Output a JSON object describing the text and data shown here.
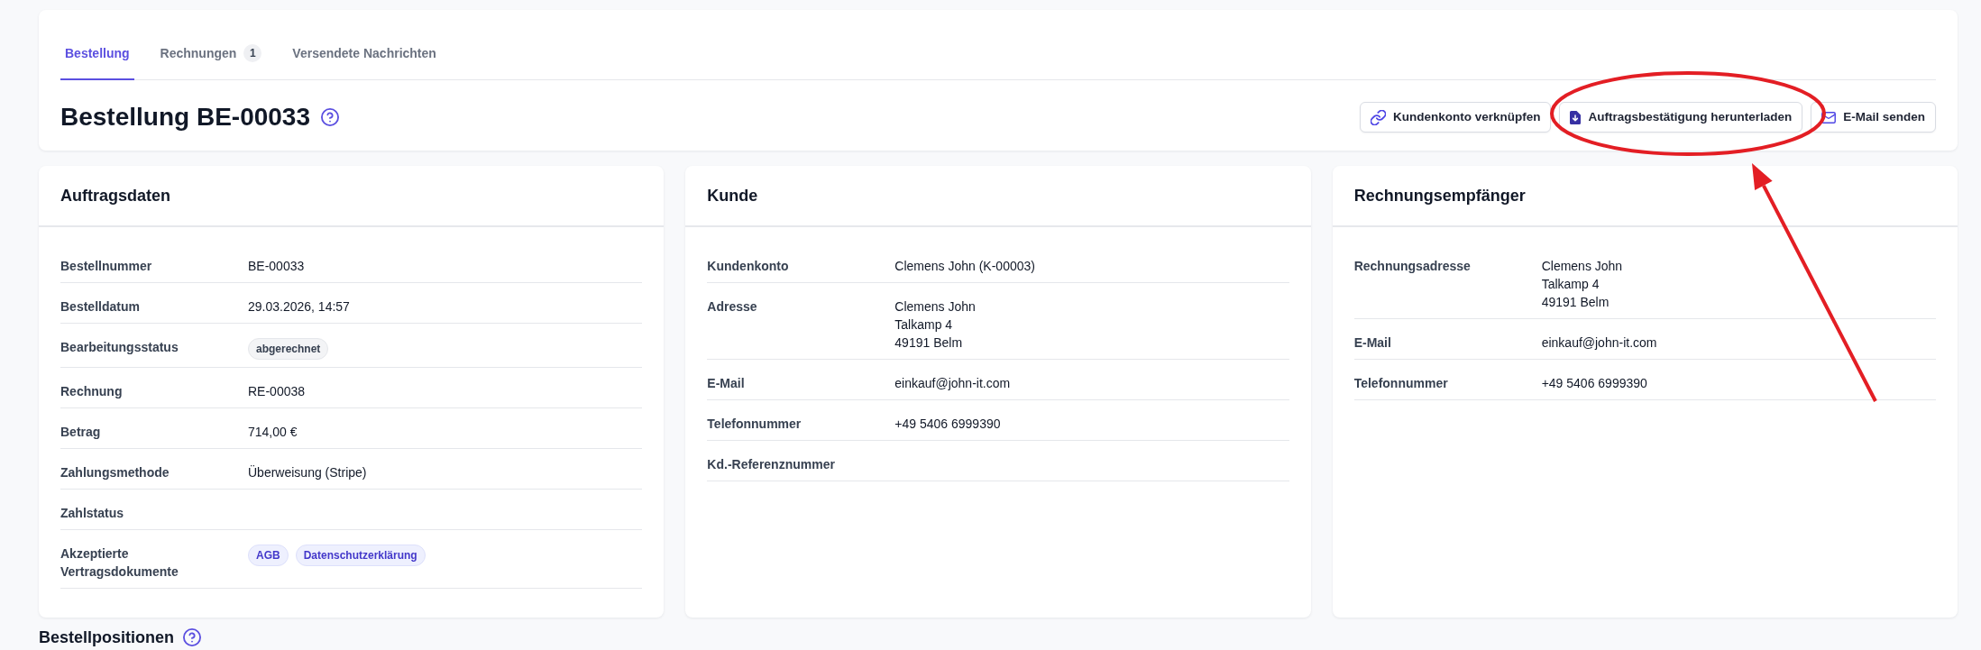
{
  "tabs": [
    {
      "label": "Bestellung",
      "selected": true
    },
    {
      "label": "Rechnungen",
      "selected": false,
      "count": "1"
    },
    {
      "label": "Versendete Nachrichten",
      "selected": false
    }
  ],
  "page_header": {
    "title": "Bestellung BE-00033",
    "buttons": [
      {
        "label": "Kundenkonto verknüpfen"
      },
      {
        "label": "Auftragsbestätigung herunterladen"
      },
      {
        "label": "E-Mail senden"
      }
    ]
  },
  "cards": [
    {
      "title": "Auftragsdaten",
      "rows": [
        {
          "kind": "text",
          "label": "Bestellnummer",
          "value": "BE-00033"
        },
        {
          "kind": "text",
          "label": "Bestelldatum",
          "value": "29.03.2026, 14:57"
        },
        {
          "kind": "status",
          "label": "Bearbeitungsstatus",
          "value": "abgerechnet"
        },
        {
          "kind": "text",
          "label": "Rechnung",
          "value": "RE-00038"
        },
        {
          "kind": "text",
          "label": "Betrag",
          "value": "714,00 €"
        },
        {
          "kind": "text",
          "label": "Zahlungsmethode",
          "value": "Überweisung (Stripe)"
        },
        {
          "kind": "empty",
          "label": "Zahlstatus"
        },
        {
          "kind": "tags",
          "label": "Akzeptierte Vertragsdokumente",
          "tags": [
            "AGB",
            "Datenschutzerklärung"
          ]
        }
      ]
    },
    {
      "title": "Kunde",
      "rows": [
        {
          "kind": "text",
          "label": "Kundenkonto",
          "value": "Clemens John (K-00003)"
        },
        {
          "kind": "lines",
          "label": "Adresse",
          "lines": [
            "Clemens John",
            "Talkamp 4",
            "49191 Belm"
          ]
        },
        {
          "kind": "text",
          "label": "E-Mail",
          "value": "einkauf@john-it.com"
        },
        {
          "kind": "text",
          "label": "Telefonnummer",
          "value": "+49 5406 6999390"
        },
        {
          "kind": "empty",
          "label": "Kd.-Referenznummer"
        }
      ]
    },
    {
      "title": "Rechnungsempfänger",
      "rows": [
        {
          "kind": "lines",
          "label": "Rechnungsadresse",
          "lines": [
            "Clemens John",
            "Talkamp 4",
            "49191 Belm"
          ]
        },
        {
          "kind": "text",
          "label": "E-Mail",
          "value": "einkauf@john-it.com"
        },
        {
          "kind": "text",
          "label": "Telefonnummer",
          "value": "+49 5406 6999390"
        }
      ]
    }
  ],
  "section": {
    "title": "Bestellpositionen"
  }
}
